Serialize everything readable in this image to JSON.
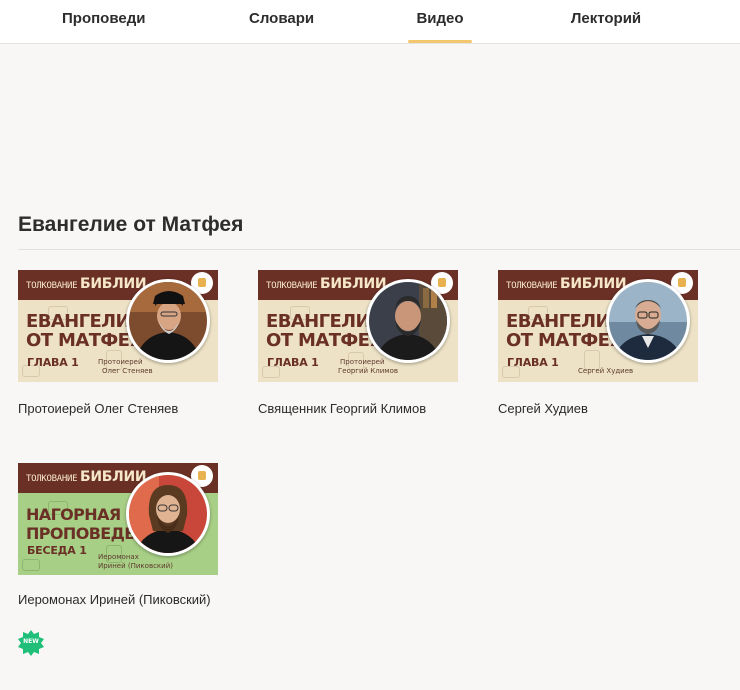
{
  "tabs": [
    {
      "label": "Проповеди",
      "active": false
    },
    {
      "label": "Словари",
      "active": false
    },
    {
      "label": "Видео",
      "active": true
    },
    {
      "label": "Лекторий",
      "active": false
    }
  ],
  "section": {
    "title": "Евангелие от Матфея"
  },
  "colors": {
    "accent": "#f2c76e",
    "band": "#6a2f25",
    "paper": "#ede2c6",
    "green": "#a8cf86",
    "new_badge": "#1fbf7a"
  },
  "videos": [
    {
      "title": "Протоиерей Олег Стеняев",
      "thumb": {
        "small": "ТОЛКОВАНИЕ",
        "big": "БИБЛИИ",
        "line1": "ЕВАНГЕЛИЕ",
        "line2": "ОТ МАТФЕЯ",
        "line3": "ГЛАВА 1",
        "rank": "Протоиерей",
        "name": "Олег Стеняев"
      }
    },
    {
      "title": "Священник Георгий Климов",
      "thumb": {
        "small": "ТОЛКОВАНИЕ",
        "big": "БИБЛИИ",
        "line1": "ЕВАНГЕЛИЕ",
        "line2": "ОТ МАТФЕЯ",
        "line3": "ГЛАВА 1",
        "rank": "Протоиерей",
        "name": "Георгий Климов"
      }
    },
    {
      "title": "Сергей Худиев",
      "thumb": {
        "small": "ТОЛКОВАНИЕ",
        "big": "БИБЛИИ",
        "line1": "ЕВАНГЕЛИЕ",
        "line2": "ОТ МАТФЕЯ",
        "line3": "ГЛАВА 1",
        "rank": "",
        "name": "Сергей Худиев"
      }
    },
    {
      "title": "Иеромонах Ириней (Пиковский)",
      "thumb": {
        "small": "ТОЛКОВАНИЕ",
        "big": "БИБЛИИ",
        "line1": "НАГОРНАЯ",
        "line2": "ПРОПОВЕДЬ",
        "line3": "БЕСЕДА 1",
        "rank": "Иеромонах",
        "name": "Ириней (Пиковский)"
      },
      "badge": "NEW"
    }
  ]
}
